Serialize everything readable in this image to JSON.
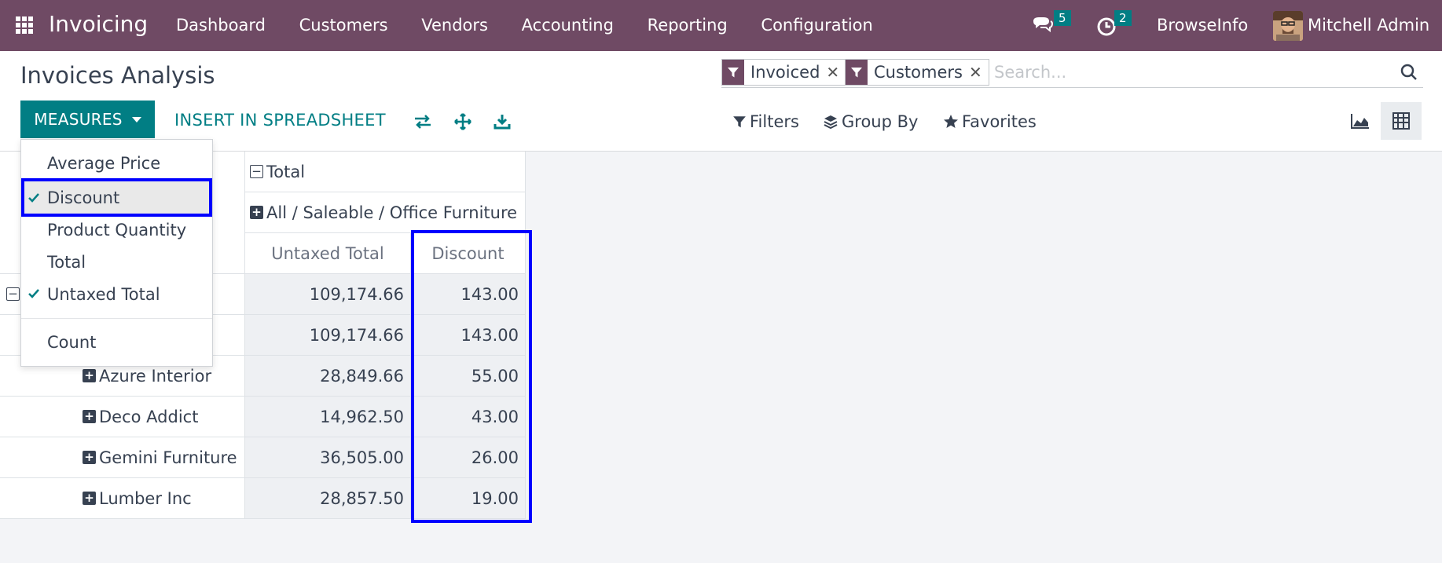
{
  "navbar": {
    "brand": "Invoicing",
    "menu": [
      "Dashboard",
      "Customers",
      "Vendors",
      "Accounting",
      "Reporting",
      "Configuration"
    ],
    "messages_count": "5",
    "activities_count": "2",
    "company": "BrowseInfo",
    "user": "Mitchell Admin"
  },
  "control_panel": {
    "title": "Invoices Analysis",
    "facets": [
      "Invoiced",
      "Customers"
    ],
    "search_placeholder": "Search...",
    "measures_label": "MEASURES",
    "insert_label": "INSERT IN SPREADSHEET",
    "filters_label": "Filters",
    "groupby_label": "Group By",
    "favorites_label": "Favorites"
  },
  "measures_dropdown": {
    "items": [
      {
        "label": "Average Price",
        "checked": false
      },
      {
        "label": "Discount",
        "checked": true
      },
      {
        "label": "Product Quantity",
        "checked": false
      },
      {
        "label": "Total",
        "checked": false
      },
      {
        "label": "Untaxed Total",
        "checked": true
      }
    ],
    "count_label": "Count"
  },
  "pivot": {
    "col_total": "Total",
    "col_group": "All / Saleable / Office Furniture",
    "measures": [
      "Untaxed Total",
      "Discount"
    ],
    "rows": [
      {
        "label": "",
        "untaxed": "109,174.66",
        "discount": "143.00"
      },
      {
        "label": "",
        "untaxed": "109,174.66",
        "discount": "143.00"
      },
      {
        "label": "Azure Interior",
        "untaxed": "28,849.66",
        "discount": "55.00"
      },
      {
        "label": "Deco Addict",
        "untaxed": "14,962.50",
        "discount": "43.00"
      },
      {
        "label": "Gemini Furniture",
        "untaxed": "36,505.00",
        "discount": "26.00"
      },
      {
        "label": "Lumber Inc",
        "untaxed": "28,857.50",
        "discount": "19.00"
      }
    ]
  },
  "colors": {
    "navbar": "#6f4a64",
    "primary": "#017e84",
    "highlight": "#0000ff"
  }
}
